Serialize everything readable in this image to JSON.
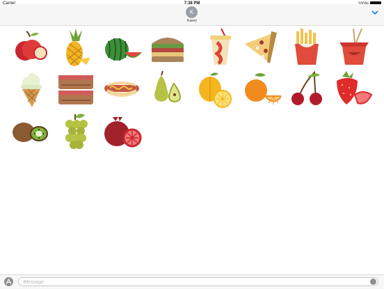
{
  "status": {
    "carrier": "Carrier",
    "time": "7:38 PM",
    "battery": "100%"
  },
  "header": {
    "avatar_letter": "K",
    "contact": "Kasey"
  },
  "composer": {
    "placeholder": "iMessage"
  },
  "stickers": [
    {
      "name": "apple"
    },
    {
      "name": "pineapple"
    },
    {
      "name": "watermelon"
    },
    {
      "name": "sandwich"
    },
    {
      "name": "soda-cup"
    },
    {
      "name": "pizza-slice"
    },
    {
      "name": "french-fries"
    },
    {
      "name": "noodle-box"
    },
    {
      "name": "ice-cream-cone"
    },
    {
      "name": "cake"
    },
    {
      "name": "hot-dog"
    },
    {
      "name": "pear"
    },
    {
      "name": "lemon"
    },
    {
      "name": "orange"
    },
    {
      "name": "cherries"
    },
    {
      "name": "strawberry"
    },
    {
      "name": "kiwi"
    },
    {
      "name": "grapes"
    },
    {
      "name": "pomegranate"
    }
  ]
}
